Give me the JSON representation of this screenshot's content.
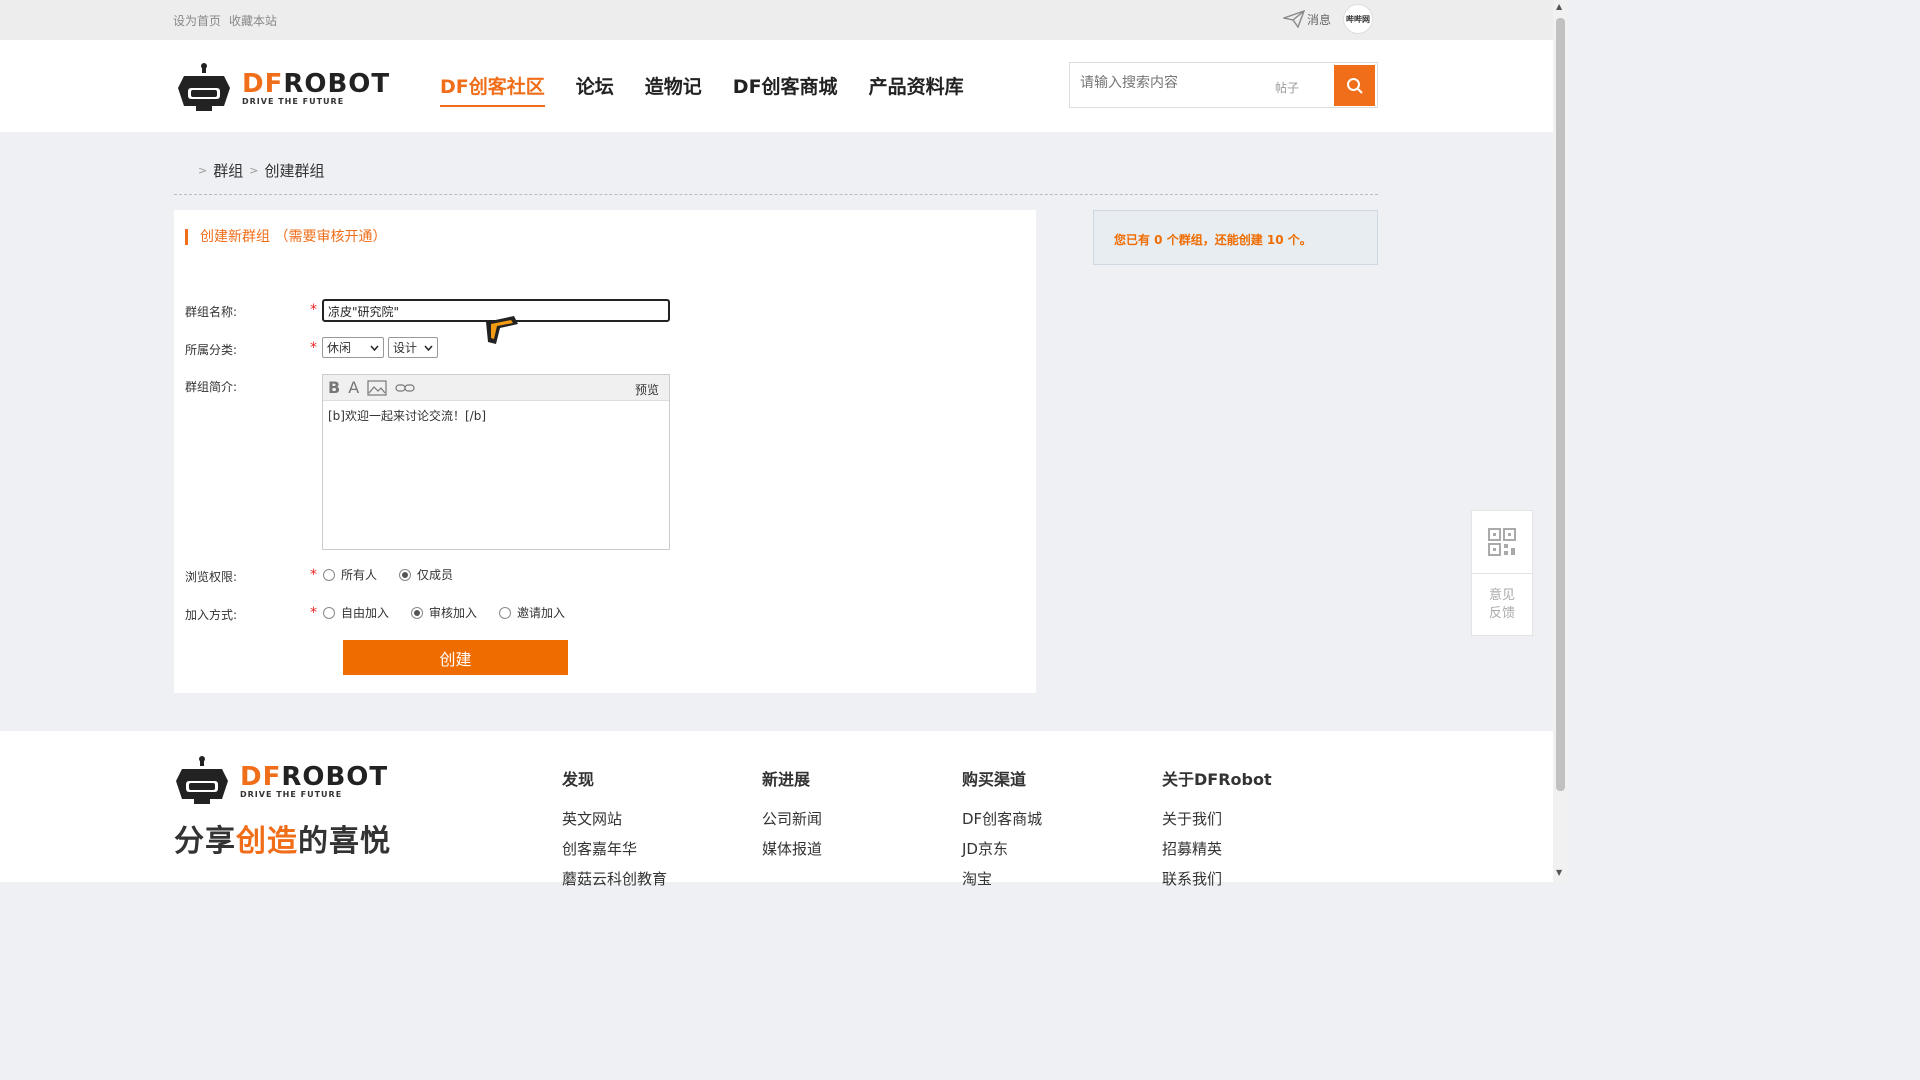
{
  "topbar": {
    "set_home": "设为首页",
    "bookmark": "收藏本站",
    "messages": "消息",
    "avatar_text": "哔哔网"
  },
  "logo": {
    "brand_df": "DF",
    "brand_robot": "ROBOT",
    "tagline": "DRIVE THE FUTURE"
  },
  "nav": {
    "items": [
      "DF创客社区",
      "论坛",
      "造物记",
      "DF创客商城",
      "产品资料库"
    ],
    "active": "DF创客社区"
  },
  "search": {
    "placeholder": "请输入搜索内容",
    "scope": "帖子"
  },
  "breadcrumb": {
    "items": [
      "群组",
      "创建群组"
    ]
  },
  "form": {
    "title": "创建新群组 （需要审核开通）",
    "name_label": "群组名称:",
    "name_value": "凉皮\"研究院\"",
    "category_label": "所属分类:",
    "category_main": "休闲",
    "category_sub": "设计",
    "intro_label": "群组简介:",
    "intro_preview": "预览",
    "intro_content": "[b]欢迎一起来讨论交流！[/b]",
    "view_label": "浏览权限:",
    "view_options": [
      "所有人",
      "仅成员"
    ],
    "view_selected": "仅成员",
    "join_label": "加入方式:",
    "join_options": [
      "自由加入",
      "审核加入",
      "邀请加入"
    ],
    "join_selected": "审核加入",
    "create_button": "创建"
  },
  "side_info": "您已有 0 个群组，还能创建 10 个。",
  "float_panel": {
    "feedback_line1": "意见",
    "feedback_line2": "反馈"
  },
  "footer": {
    "slogan_pre": "分享",
    "slogan_mid": "创造",
    "slogan_post": "的喜悦",
    "columns": [
      {
        "heading": "发现",
        "items": [
          "英文网站",
          "创客嘉年华",
          "蘑菇云科创教育"
        ]
      },
      {
        "heading": "新进展",
        "items": [
          "公司新闻",
          "媒体报道"
        ]
      },
      {
        "heading": "购买渠道",
        "items": [
          "DF创客商城",
          "JD京东",
          "淘宝"
        ]
      },
      {
        "heading": "关于DFRobot",
        "items": [
          "关于我们",
          "招募精英",
          "联系我们"
        ]
      }
    ]
  },
  "colors": {
    "accent": "#f06e1a",
    "button": "#ef6c00"
  }
}
